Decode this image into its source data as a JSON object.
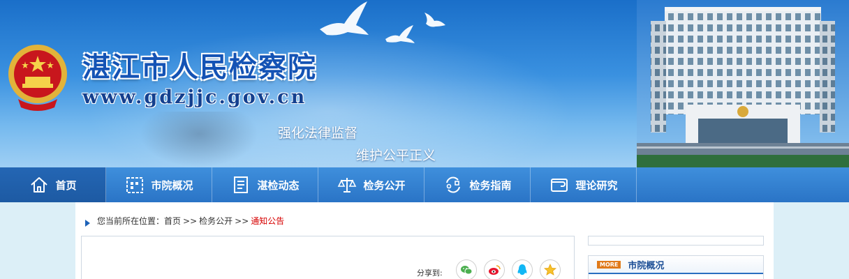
{
  "header": {
    "site_title": "湛江市人民检察院",
    "site_url": "www.gdzjjc.gov.cn",
    "slogan_line1": "强化法律监督",
    "slogan_line2": "维护公平正义"
  },
  "nav": {
    "items": [
      {
        "label": "首页",
        "icon": "home-icon"
      },
      {
        "label": "市院概况",
        "icon": "grid-icon"
      },
      {
        "label": "湛检动态",
        "icon": "document-icon"
      },
      {
        "label": "检务公开",
        "icon": "scale-icon"
      },
      {
        "label": "检务指南",
        "icon": "guide-icon"
      },
      {
        "label": "理论研究",
        "icon": "wallet-icon"
      }
    ],
    "active_index": 0
  },
  "breadcrumb": {
    "prefix": "您当前所在位置：",
    "items": [
      "首页",
      "检务公开",
      "通知公告"
    ],
    "separator": ">>"
  },
  "share": {
    "label": "分享到:",
    "buttons": [
      "wechat-icon",
      "weibo-icon",
      "qq-icon",
      "qzone-icon"
    ]
  },
  "sidebar": {
    "more_label": "MORE",
    "section_title": "市院概况"
  },
  "colors": {
    "nav_bg": "#2a74c6",
    "breadcrumb_current": "#d60000",
    "more_tag": "#e07a1a"
  }
}
